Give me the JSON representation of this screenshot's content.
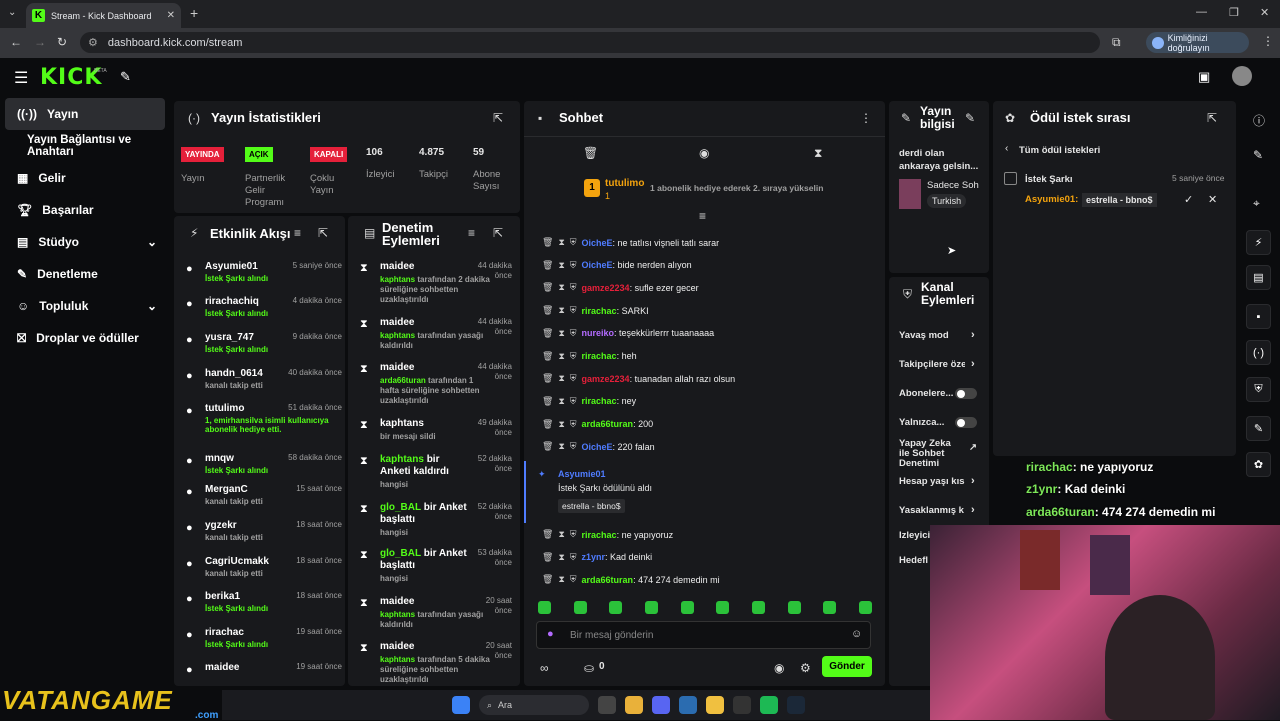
{
  "browser": {
    "tab_title": "Stream - Kick Dashboard",
    "url": "dashboard.kick.com/stream",
    "verify_label": "Kimliğinizi doğrulayın"
  },
  "logo": {
    "text": "KICK",
    "beta": "BETA"
  },
  "sidebar": {
    "items": [
      {
        "label": "Yayın"
      },
      {
        "label": "Yayın Bağlantısı ve Anahtarı"
      },
      {
        "label": "Gelir"
      },
      {
        "label": "Başarılar"
      },
      {
        "label": "Stüdyo"
      },
      {
        "label": "Denetleme"
      },
      {
        "label": "Topluluk"
      },
      {
        "label": "Droplar ve ödüller"
      }
    ]
  },
  "stats": {
    "title": "Yayın İstatistikleri",
    "cells": [
      {
        "badge": "YAYINDA",
        "label": "Yayın"
      },
      {
        "badge": "AÇIK",
        "label": "Partnerlik Gelir Programı"
      },
      {
        "badge": "KAPALI",
        "label": "Çoklu Yayın"
      },
      {
        "value": "106",
        "label": "İzleyici"
      },
      {
        "value": "4.875",
        "label": "Takipçi"
      },
      {
        "value": "59",
        "label": "Abone Sayısı"
      }
    ]
  },
  "activity": {
    "title": "Etkinlik Akışı",
    "items": [
      {
        "name": "Asyumie01",
        "time": "5 saniye önce",
        "sub": "İstek Şarkı alındı"
      },
      {
        "name": "rirachachiq",
        "time": "4 dakika önce",
        "sub": "İstek Şarkı alındı"
      },
      {
        "name": "yusra_747",
        "time": "9 dakika önce",
        "sub": "İstek Şarkı alındı"
      },
      {
        "name": "handn_0614",
        "time": "40 dakika önce",
        "sub": "kanalı takip etti"
      },
      {
        "name": "tutulimo",
        "time": "51 dakika önce",
        "sub": "1, emirhansilva isimli kullanıcıya abonelik hediye etti."
      },
      {
        "name": "mnqw",
        "time": "58 dakika önce",
        "sub": "İstek Şarkı alındı"
      },
      {
        "name": "MerganC",
        "time": "15 saat önce",
        "sub": "kanalı takip etti"
      },
      {
        "name": "ygzekr",
        "time": "18 saat önce",
        "sub": "kanalı takip etti"
      },
      {
        "name": "CagriUcmakk",
        "time": "18 saat önce",
        "sub": "kanalı takip etti"
      },
      {
        "name": "berika1",
        "time": "18 saat önce",
        "sub": "İstek Şarkı alındı"
      },
      {
        "name": "rirachac",
        "time": "19 saat önce",
        "sub": "İstek Şarkı alındı"
      },
      {
        "name": "maidee",
        "time": "19 saat önce",
        "sub": ""
      }
    ]
  },
  "moderation": {
    "title": "Denetim Eylemleri",
    "items": [
      {
        "name": "maidee",
        "time": "44 dakika önce",
        "actor": "kaphtans",
        "sub": "tarafından 2 dakika süreliğine sohbetten uzaklaştırıldı"
      },
      {
        "name": "maidee",
        "time": "44 dakika önce",
        "actor": "kaphtans",
        "sub": "tarafından yasağı kaldırıldı"
      },
      {
        "name": "maidee",
        "time": "44 dakika önce",
        "actor": "arda66turan",
        "sub": "tarafından 1 hafta süreliğine sohbetten uzaklaştırıldı"
      },
      {
        "name": "kaphtans",
        "time": "49 dakika önce",
        "actor": "",
        "sub": "bir mesajı sildi"
      },
      {
        "name": "kaphtans",
        "name_rest": "bir Anketi kaldırdı",
        "time": "52 dakika önce",
        "actor": "",
        "sub": "hangisi"
      },
      {
        "name": "glo_BAL",
        "name_rest": "bir Anket başlattı",
        "time": "52 dakika önce",
        "actor": "",
        "sub": "hangisi"
      },
      {
        "name": "glo_BAL",
        "name_rest": "bir Anket başlattı",
        "time": "53 dakika önce",
        "actor": "",
        "sub": "hangisi"
      },
      {
        "name": "maidee",
        "time": "20 saat önce",
        "actor": "kaphtans",
        "sub": "tarafından yasağı kaldırıldı"
      },
      {
        "name": "maidee",
        "time": "20 saat önce",
        "actor": "kaphtans",
        "sub": "tarafından 5 dakika süreliğine sohbetten uzaklaştırıldı"
      }
    ]
  },
  "chat": {
    "title": "Sohbet",
    "gift_user": "tutulimo",
    "gift_count": "1",
    "gift_text": "1 abonelik hediye ederek 2. sıraya yükselin",
    "messages": [
      {
        "name": "OicheE",
        "color": "#4f7cff",
        "text": ": ne tatlısı vişneli tatlı sarar"
      },
      {
        "name": "OicheE",
        "color": "#4f7cff",
        "text": ": bide nerden alıyon"
      },
      {
        "name": "gamze2234",
        "color": "#e5203a",
        "text": ": sufle ezer gecer"
      },
      {
        "name": "rirachac",
        "color": "#53fc18",
        "text": ": SARKI"
      },
      {
        "name": "nureiko",
        "color": "#b36bff",
        "text": ": teşekkürlerrr tuaanaaaa"
      },
      {
        "name": "rirachac",
        "color": "#53fc18",
        "text": ": heh"
      },
      {
        "name": "gamze2234",
        "color": "#e5203a",
        "text": ": tuanadan allah razı olsun"
      },
      {
        "name": "rirachac",
        "color": "#53fc18",
        "text": ": ney"
      },
      {
        "name": "arda66turan",
        "color": "#53fc18",
        "text": ": 200"
      },
      {
        "name": "OicheE",
        "color": "#4f7cff",
        "text": ": 220 falan"
      }
    ],
    "redeem": {
      "user": "Asyumie01",
      "text": "İstek Şarkı ödülünü aldı",
      "song": "estrella - bbno$"
    },
    "messages2": [
      {
        "name": "rirachac",
        "color": "#53fc18",
        "text": ": ne yapıyoruz"
      },
      {
        "name": "z1ynr",
        "color": "#4f7cff",
        "text": ": Kad deinki"
      },
      {
        "name": "arda66turan",
        "color": "#53fc18",
        "text": ": 474 274 demedin mi"
      }
    ],
    "input_placeholder": "Bir mesaj gönderin",
    "points": "0",
    "send_label": "Gönder"
  },
  "stream_info": {
    "title": "Yayın bilgisi",
    "stream_title": "derdi olan ankaraya gelsin...",
    "category": "Sadece Soh",
    "language": "Turkish"
  },
  "channel_actions": {
    "title": "Kanal Eylemleri",
    "items": [
      {
        "label": "Yavaş mod"
      },
      {
        "label": "Takipçilere öze"
      },
      {
        "label": "Abonelere..."
      },
      {
        "label": "Yalnızca..."
      },
      {
        "label": "Yapay Zeka ile Sohbet Denetimi"
      },
      {
        "label": "Hesap yaşı kıs"
      },
      {
        "label": "Yasaklanmış k"
      },
      {
        "label": "İzleyici"
      },
      {
        "label": "Hedefl"
      }
    ]
  },
  "rewards": {
    "title": "Ödül istek sırası",
    "back_label": "Tüm ödül istekleri",
    "reward_name": "İstek Şarkı",
    "reward_time": "5 saniye önce",
    "request_user": "Asyumie01:",
    "request_song": "estrella - bbno$"
  },
  "overlay": {
    "lines": [
      {
        "name": "rirachac",
        "text": ": ne yapıyoruz"
      },
      {
        "name": "z1ynr",
        "text": ": Kad deinki"
      },
      {
        "name": "arda66turan",
        "text": ": 474 274 demedin mi"
      }
    ],
    "watermark": "VATANGAME",
    "watermark_sub": ".com"
  },
  "taskbar": {
    "search_label": "Ara"
  }
}
